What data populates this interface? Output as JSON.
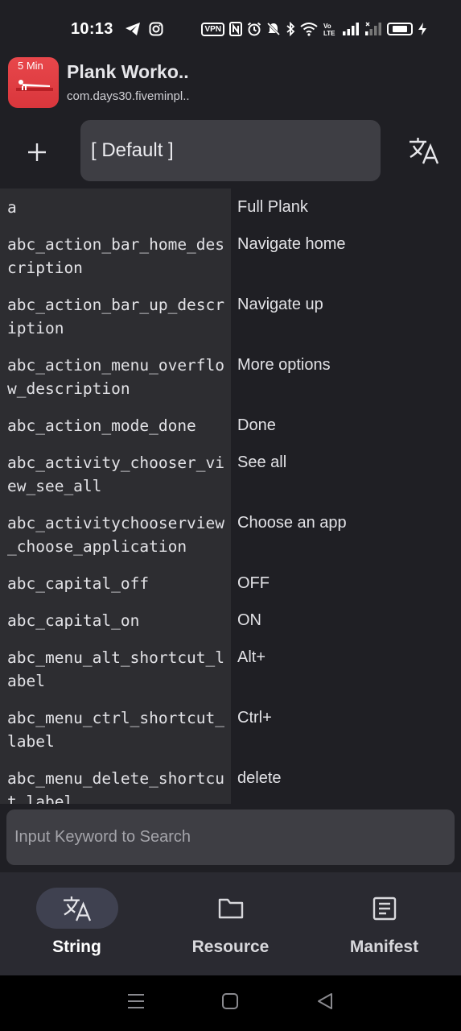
{
  "status_bar": {
    "time": "10:13",
    "vpn_label": "VPN",
    "battery_level": 0.75,
    "icons": [
      "telegram-icon",
      "instagram-icon",
      "vpn-icon",
      "nfc-icon",
      "alarm-icon",
      "mute-icon",
      "bluetooth-icon",
      "wifi-icon",
      "volte-icon",
      "signal-icon",
      "signal-2-icon",
      "battery-icon",
      "charging-icon"
    ]
  },
  "app": {
    "icon_badge": "5 Min",
    "title": "Plank Worko..",
    "package": "com.days30.fiveminpl.."
  },
  "toolbar": {
    "language": "[ Default ]"
  },
  "strings": [
    {
      "key": "a",
      "value": "Full Plank"
    },
    {
      "key": "abc_action_bar_home_description",
      "value": "Navigate home"
    },
    {
      "key": "abc_action_bar_up_description",
      "value": "Navigate up"
    },
    {
      "key": "abc_action_menu_overflow_description",
      "value": "More options"
    },
    {
      "key": "abc_action_mode_done",
      "value": "Done"
    },
    {
      "key": "abc_activity_chooser_view_see_all",
      "value": "See all"
    },
    {
      "key": "abc_activitychooserview_choose_application",
      "value": "Choose an app"
    },
    {
      "key": "abc_capital_off",
      "value": "OFF"
    },
    {
      "key": "abc_capital_on",
      "value": "ON"
    },
    {
      "key": "abc_menu_alt_shortcut_label",
      "value": "Alt+"
    },
    {
      "key": "abc_menu_ctrl_shortcut_label",
      "value": "Ctrl+"
    },
    {
      "key": "abc_menu_delete_shortcut_label",
      "value": "delete"
    }
  ],
  "search": {
    "placeholder": "Input Keyword to Search",
    "value": ""
  },
  "bottom_nav": {
    "items": [
      {
        "label": "String",
        "icon": "translate-icon",
        "active": true
      },
      {
        "label": "Resource",
        "icon": "folder-icon",
        "active": false
      },
      {
        "label": "Manifest",
        "icon": "document-icon",
        "active": false
      }
    ]
  },
  "colors": {
    "background": "#1f1f24",
    "key_column": "#2d2d31",
    "input": "#3e3e44",
    "nav_bar": "#2a2a31",
    "nav_active_pill": "#3f4150",
    "app_icon": "#e8474b"
  }
}
